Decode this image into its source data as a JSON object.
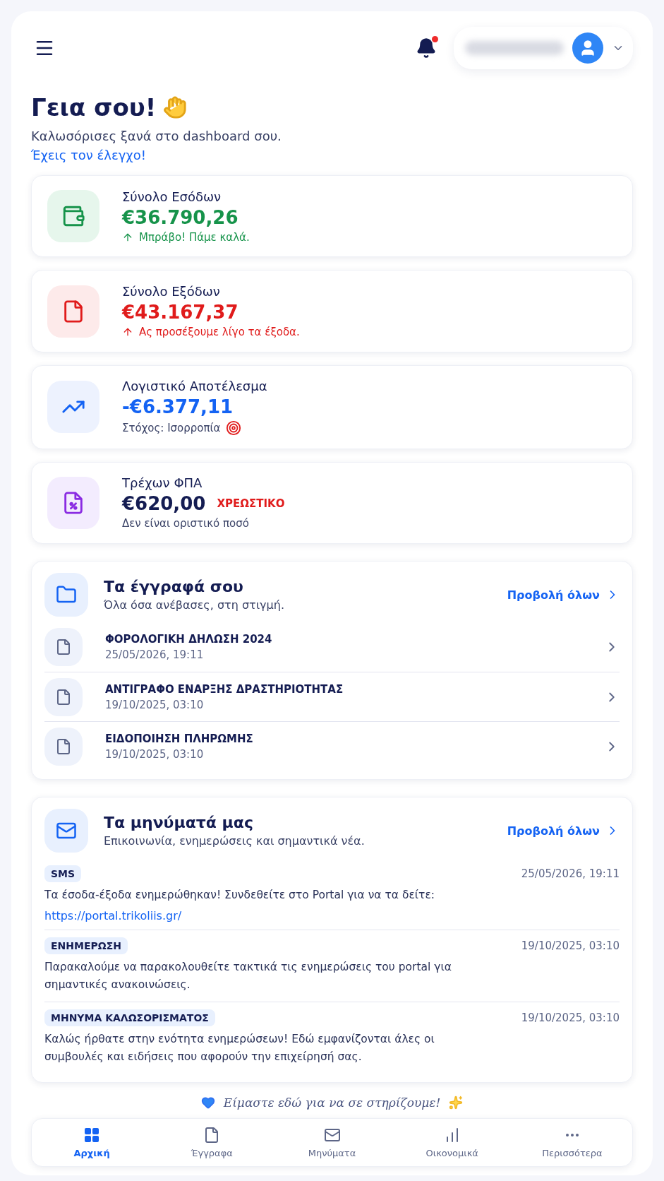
{
  "header": {
    "has_unread": true
  },
  "greeting": {
    "title": "Γεια σου!",
    "subtitle": "Καλωσόρισες ξανά στο dashboard σου.",
    "link": "Έχεις τον έλεγχο!"
  },
  "stat_cards": [
    {
      "kind": "income",
      "label": "Σύνολο Εσόδων",
      "amount": "€36.790,26",
      "note": "Μπράβο! Πάμε καλά."
    },
    {
      "kind": "expense",
      "label": "Σύνολο Εξόδων",
      "amount": "€43.167,37",
      "note": "Ας προσέξουμε λίγο τα έξοδα."
    },
    {
      "kind": "result",
      "label": "Λογιστικό Αποτέλεσμα",
      "amount": "-€6.377,11",
      "note": "Στόχος: Ισορροπία"
    },
    {
      "kind": "vat",
      "label": "Τρέχων ΦΠΑ",
      "amount": "€620,00",
      "badge": "ΧΡΕΩΣΤΙΚΟ",
      "note": "Δεν είναι οριστικό ποσό"
    }
  ],
  "documents": {
    "title": "Τα έγγραφά σου",
    "subtitle": "Όλα όσα ανέβασες, στη στιγμή.",
    "view_all": "Προβολή όλων",
    "items": [
      {
        "name": "ΦΟΡΟΛΟΓΙΚΗ ΔΗΛΩΣΗ 2024",
        "date": "25/05/2026, 19:11"
      },
      {
        "name": "ΑΝΤΙΓΡΑΦΟ ΕΝΑΡΞΗΣ ΔΡΑΣΤΗΡΙΟΤΗΤΑΣ",
        "date": "19/10/2025, 03:10"
      },
      {
        "name": "ΕΙΔΟΠΟΙΗΣΗ ΠΛΗΡΩΜΗΣ",
        "date": "19/10/2025, 03:10"
      }
    ]
  },
  "messages": {
    "title": "Τα μηνύματά μας",
    "subtitle": "Επικοινωνία, ενημερώσεις και σημαντικά νέα.",
    "view_all": "Προβολή όλων",
    "items": [
      {
        "tag": "SMS",
        "date": "25/05/2026, 19:11",
        "text": "Τα έσοδα-έξοδα ενημερώθηκαν! Συνδεθείτε στο Portal για να τα δείτε:",
        "link": "https://portal.trikoliis.gr/"
      },
      {
        "tag": "ΕΝΗΜΕΡΩΣΗ",
        "date": "19/10/2025, 03:10",
        "text": "Παρακαλούμε να παρακολουθείτε τακτικά τις ενημερώσεις του portal για σημαντικές ανακοινώσεις."
      },
      {
        "tag": "ΜΗΝΥΜΑ ΚΑΛΩΣΟΡΙΣΜΑΤΟΣ",
        "date": "19/10/2025, 03:10",
        "text": "Καλώς ήρθατε στην ενότητα ενημερώσεων! Εδώ εμφανίζονται άλες οι συμβουλές και ειδήσεις που αφορούν την επιχείρησή σας."
      }
    ]
  },
  "footer_note": "Είμαστε εδώ για να σε στηρίζουμε!",
  "bottom_nav": [
    {
      "kind": "home",
      "label": "Αρχική",
      "selected": true
    },
    {
      "kind": "documents",
      "label": "Έγγραφα",
      "selected": false
    },
    {
      "kind": "messages",
      "label": "Μηνύματα",
      "selected": false
    },
    {
      "kind": "finance",
      "label": "Οικονομικά",
      "selected": false
    },
    {
      "kind": "more",
      "label": "Περισσότερα",
      "selected": false
    }
  ]
}
